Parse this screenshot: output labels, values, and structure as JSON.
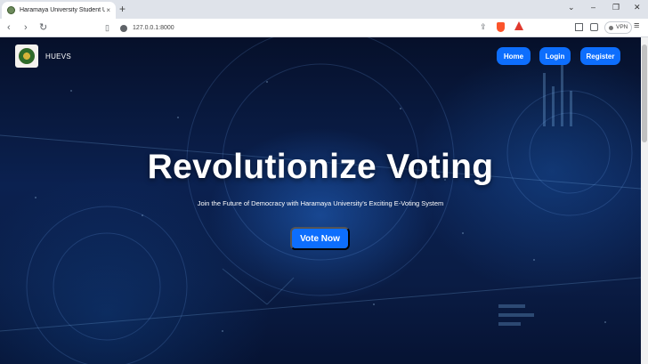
{
  "browser": {
    "tab_title": "Haramaya University Student U",
    "tab_close": "×",
    "new_tab": "+",
    "url": "127.0.0.1:8000",
    "vpn_label": "VPN",
    "window_controls": [
      "⌄",
      "–",
      "❐",
      "✕"
    ],
    "nav": {
      "back": "‹",
      "forward": "›",
      "reload": "↻"
    },
    "menu": "≡"
  },
  "site": {
    "brand": "HUEVS",
    "nav_items": [
      "Home",
      "Login",
      "Register"
    ]
  },
  "hero": {
    "title": "Revolutionize Voting",
    "subtitle": "Join the Future of Democracy with Haramaya University's Exciting E-Voting System",
    "cta": "Vote Now"
  },
  "colors": {
    "accent": "#0d6efd",
    "background": "#0a1c44"
  }
}
